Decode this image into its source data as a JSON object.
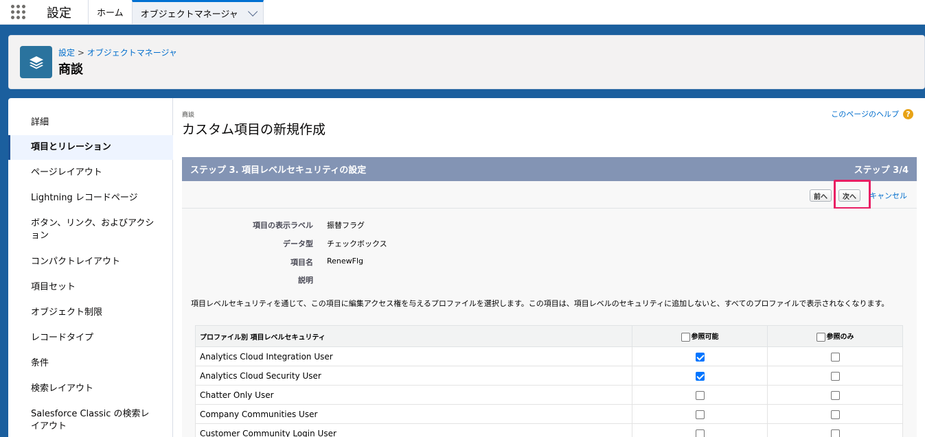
{
  "topnav": {
    "app_name": "設定",
    "tabs": [
      {
        "label": "ホーム"
      },
      {
        "label": "オブジェクトマネージャ"
      }
    ]
  },
  "header": {
    "breadcrumb_1": "設定",
    "breadcrumb_sep": " > ",
    "breadcrumb_2": "オブジェクトマネージャ",
    "title": "商談"
  },
  "sidebar": {
    "items": [
      {
        "label": "詳細"
      },
      {
        "label": "項目とリレーション"
      },
      {
        "label": "ページレイアウト"
      },
      {
        "label": "Lightning レコードページ"
      },
      {
        "label": "ボタン、リンク、およびアクション"
      },
      {
        "label": "コンパクトレイアウト"
      },
      {
        "label": "項目セット"
      },
      {
        "label": "オブジェクト制限"
      },
      {
        "label": "レコードタイプ"
      },
      {
        "label": "条件"
      },
      {
        "label": "検索レイアウト"
      },
      {
        "label": "Salesforce Classic の検索レイアウト"
      }
    ]
  },
  "content": {
    "object_small": "商談",
    "page_title": "カスタム項目の新規作成",
    "help_link": "このページのヘルプ",
    "help_icon": "?",
    "step_title": "ステップ 3. 項目レベルセキュリティの設定",
    "step_count": "ステップ 3/4",
    "prev_button": "前へ",
    "next_button": "次へ",
    "cancel_link": "キャンセル",
    "details": {
      "label_label": "項目の表示ラベル",
      "label_value": "振替フラグ",
      "type_label": "データ型",
      "type_value": "チェックボックス",
      "name_label": "項目名",
      "name_value": "RenewFlg",
      "desc_label": "説明"
    },
    "description": "項目レベルセキュリティを通じて、この項目に編集アクセス権を与えるプロファイルを選択します。この項目は、項目レベルのセキュリティに追加しないと、すべてのプロファイルで表示されなくなります。",
    "table": {
      "headers": [
        "プロファイル別 項目レベルセキュリティ",
        "参照可能",
        "参照のみ"
      ],
      "rows": [
        {
          "profile": "Analytics Cloud Integration User",
          "visible": true,
          "readonly": false
        },
        {
          "profile": "Analytics Cloud Security User",
          "visible": true,
          "readonly": false
        },
        {
          "profile": "Chatter Only User",
          "visible": false,
          "readonly": false
        },
        {
          "profile": "Company Communities User",
          "visible": false,
          "readonly": false
        },
        {
          "profile": "Customer Community Login User",
          "visible": false,
          "readonly": false
        }
      ]
    }
  },
  "colors": {
    "brand_blue": "#1b5f9e",
    "step_bar": "#8394b4",
    "link": "#006dcc",
    "highlight": "#e91e63"
  }
}
